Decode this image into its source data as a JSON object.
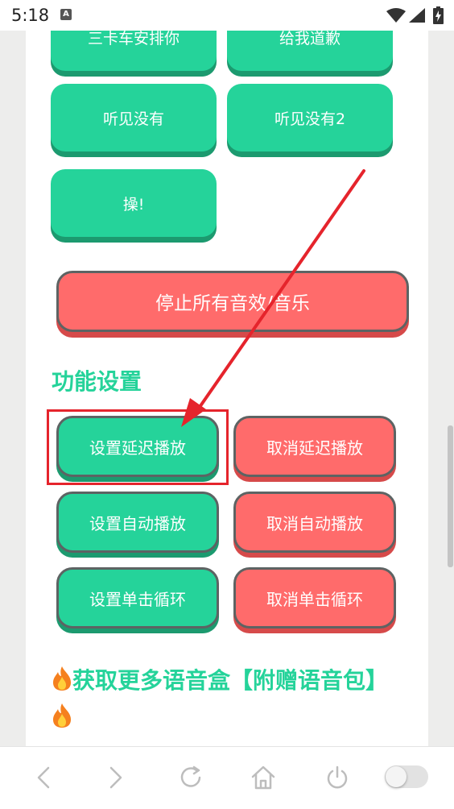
{
  "status_bar": {
    "time": "5:18",
    "notification_letter": "A"
  },
  "sound_buttons": [
    {
      "label": "三卡车安排你"
    },
    {
      "label": "给我道歉"
    },
    {
      "label": "听见没有"
    },
    {
      "label": "听见没有2"
    },
    {
      "label": "操!"
    }
  ],
  "stop_button": {
    "label": "停止所有音效/音乐"
  },
  "function_settings": {
    "title": "功能设置",
    "buttons": [
      {
        "label": "设置延迟播放"
      },
      {
        "label": "取消延迟播放"
      },
      {
        "label": "设置自动播放"
      },
      {
        "label": "取消自动播放"
      },
      {
        "label": "设置单击循环"
      },
      {
        "label": "取消单击循环"
      }
    ]
  },
  "more_section": {
    "title": "获取更多语音盒【附赠语音包】"
  },
  "colors": {
    "accent_green": "#25d39a",
    "accent_red": "#ff6b6b",
    "annotation_red": "#e5242c"
  }
}
